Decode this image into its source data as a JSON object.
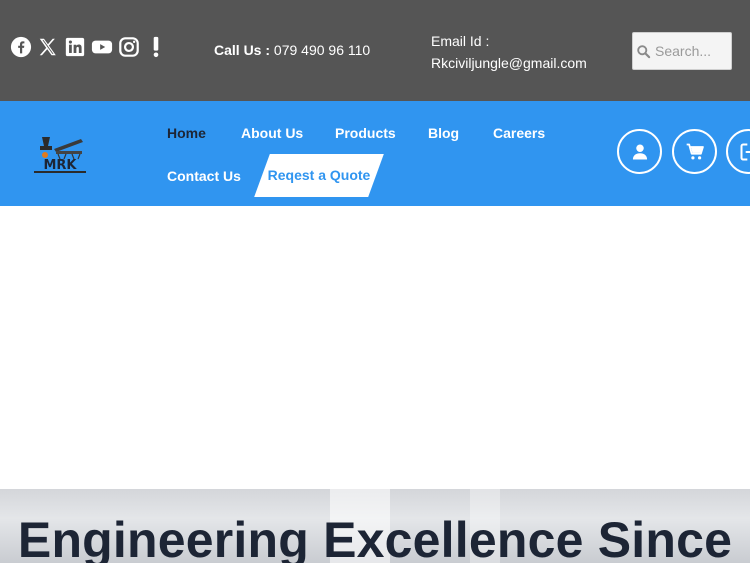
{
  "topbar": {
    "social_icons": [
      "facebook-icon",
      "x-twitter-icon",
      "linkedin-icon",
      "youtube-icon",
      "instagram-icon",
      "exclamation-icon"
    ],
    "call_label": "Call Us :",
    "call_number": " 079 490 96 110",
    "email_label": "Email Id :",
    "email_value": "Rkciviljungle@gmail.com",
    "search_placeholder": "Search..."
  },
  "nav": {
    "logo_text": "MRK",
    "items": [
      {
        "label": "Home"
      },
      {
        "label": "About Us"
      },
      {
        "label": "Products"
      },
      {
        "label": "Blog"
      },
      {
        "label": "Careers"
      },
      {
        "label": "Contact Us"
      }
    ],
    "quote_label": "Reqest a Quote",
    "icons": [
      "user-icon",
      "cart-icon",
      "logout-icon"
    ]
  },
  "hero": {
    "title": "Engineering Excellence Since"
  },
  "colors": {
    "topbar_bg": "#555555",
    "nav_bg": "#3095f0",
    "active_nav": "#1d2535",
    "hero_text": "#1d2535"
  }
}
